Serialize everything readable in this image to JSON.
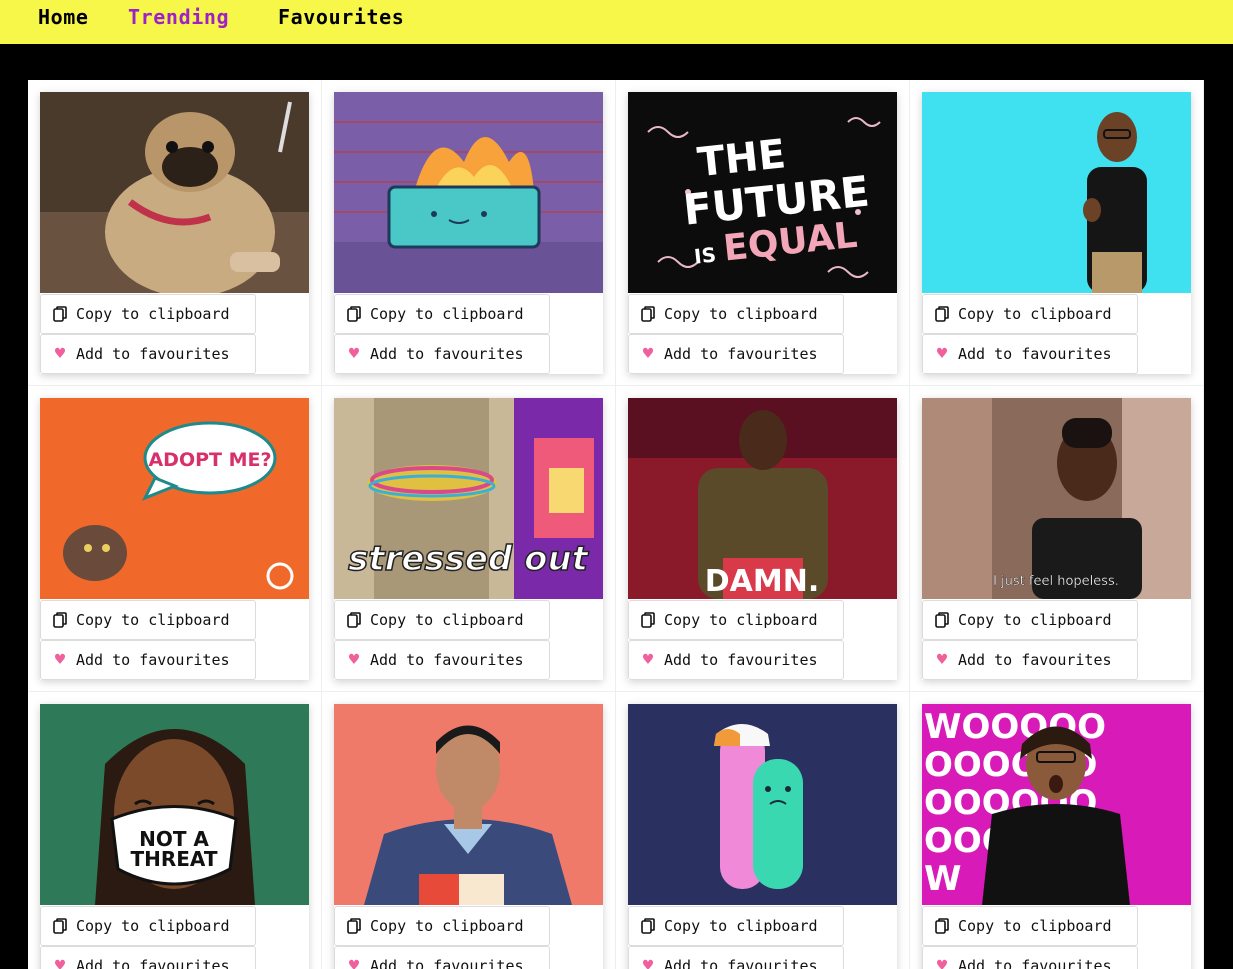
{
  "nav": {
    "items": [
      {
        "label": "Home",
        "active": false
      },
      {
        "label": "Trending",
        "active": true
      },
      {
        "label": "Favourites",
        "active": false
      }
    ],
    "active_color": "#a020c8",
    "bar_color": "#f7f74a"
  },
  "buttons": {
    "copy_label": "Copy to clipboard",
    "fav_label": "Add to favourites",
    "copy_icon": "clipboard-icon",
    "fav_icon": "heart-icon",
    "heart_color": "#f0609c"
  },
  "gifs": [
    {
      "id": "pug",
      "caption": ""
    },
    {
      "id": "dumpster-fire",
      "caption": ""
    },
    {
      "id": "future-equal",
      "caption": "THE FUTURE IS EQUAL"
    },
    {
      "id": "woman-sign",
      "caption": ""
    },
    {
      "id": "adopt-me",
      "caption": "ADOPT ME?"
    },
    {
      "id": "stressed-out",
      "caption": "stressed out"
    },
    {
      "id": "damn",
      "caption": "DAMN."
    },
    {
      "id": "hopeless",
      "caption": "I just feel hopeless."
    },
    {
      "id": "not-a-threat",
      "caption": "NOT A THREAT"
    },
    {
      "id": "young-man",
      "caption": ""
    },
    {
      "id": "hug",
      "caption": ""
    },
    {
      "id": "woo",
      "caption": "WOOOOO"
    }
  ]
}
